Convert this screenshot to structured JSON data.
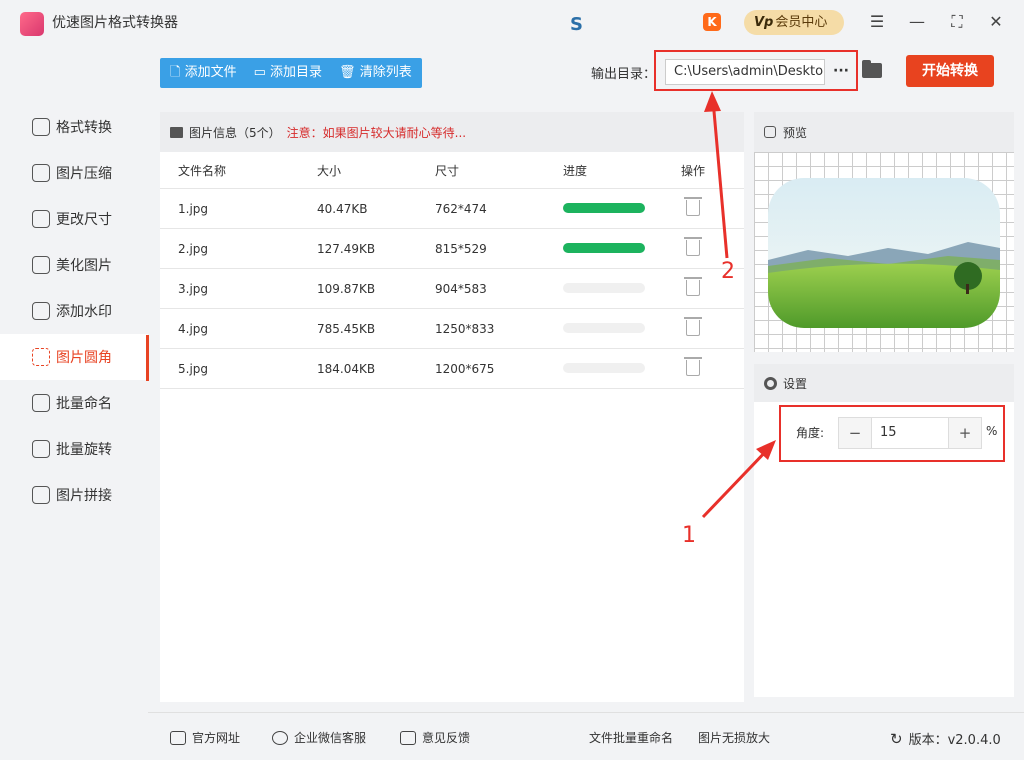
{
  "app": {
    "title": "优速图片格式转换器"
  },
  "titlebar": {
    "vip_label": "会员中心",
    "vip_badge": "Vp",
    "k_badge": "K"
  },
  "sidebar": {
    "items": [
      {
        "label": "格式转换",
        "icon": "format-convert-icon"
      },
      {
        "label": "图片压缩",
        "icon": "compress-icon"
      },
      {
        "label": "更改尺寸",
        "icon": "resize-icon"
      },
      {
        "label": "美化图片",
        "icon": "beautify-icon"
      },
      {
        "label": "添加水印",
        "icon": "watermark-icon"
      },
      {
        "label": "图片圆角",
        "icon": "rounded-corner-icon",
        "active": true
      },
      {
        "label": "批量命名",
        "icon": "rename-icon"
      },
      {
        "label": "批量旋转",
        "icon": "rotate-icon"
      },
      {
        "label": "图片拼接",
        "icon": "stitch-icon"
      }
    ]
  },
  "toolbar": {
    "add_file": "添加文件",
    "add_dir": "添加目录",
    "clear_list": "清除列表",
    "output_label": "输出目录：",
    "output_path": "C:\\Users\\admin\\Desktop",
    "more": "···",
    "start": "开始转换"
  },
  "file_panel": {
    "title": "图片信息（5个）",
    "warning": "注意：如果图片较大请耐心等待...",
    "columns": [
      "文件名称",
      "大小",
      "尺寸",
      "进度",
      "操作"
    ],
    "rows": [
      {
        "name": "1.jpg",
        "size": "40.47KB",
        "dim": "762*474",
        "progress": 1.0
      },
      {
        "name": "2.jpg",
        "size": "127.49KB",
        "dim": "815*529",
        "progress": 1.0
      },
      {
        "name": "3.jpg",
        "size": "109.87KB",
        "dim": "904*583",
        "progress": 0
      },
      {
        "name": "4.jpg",
        "size": "785.45KB",
        "dim": "1250*833",
        "progress": 0
      },
      {
        "name": "5.jpg",
        "size": "184.04KB",
        "dim": "1200*675",
        "progress": 0
      }
    ]
  },
  "preview": {
    "title": "预览"
  },
  "settings": {
    "title": "设置",
    "angle_label": "角度:",
    "angle_value": "15",
    "unit": "%",
    "minus": "−",
    "plus": "+"
  },
  "annotations": {
    "one": "1",
    "two": "2"
  },
  "footer": {
    "site": "官方网址",
    "wechat": "企业微信客服",
    "feedback": "意见反馈",
    "rename": "文件批量重命名",
    "enlarge": "图片无损放大",
    "version": "版本：v2.0.4.0"
  },
  "colors": {
    "accent": "#e84323",
    "toolbar_blue": "#3aa0e6",
    "progress_green": "#1cb35e",
    "annotation_red": "#e8302a"
  }
}
